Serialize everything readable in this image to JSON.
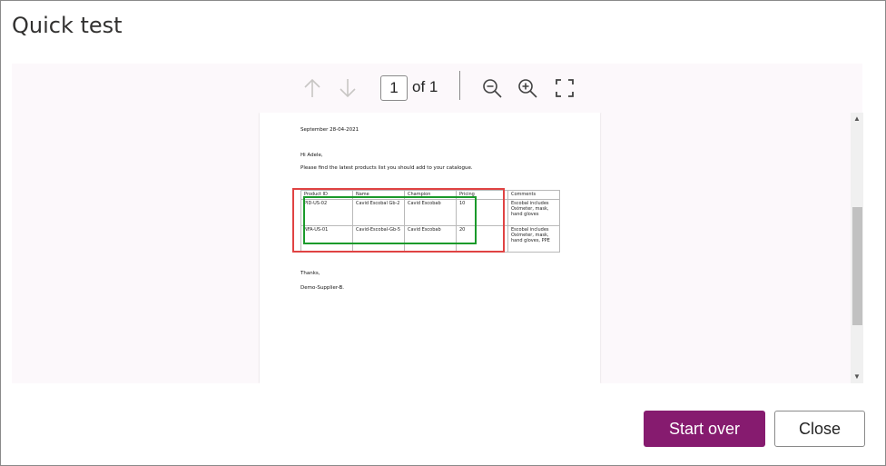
{
  "dialog": {
    "title": "Quick test"
  },
  "toolbar": {
    "prev_icon": "arrow-up-icon",
    "next_icon": "arrow-down-icon",
    "page_value": "1",
    "page_of": "of 1",
    "zoom_out_icon": "zoom-out-icon",
    "zoom_in_icon": "zoom-in-icon",
    "fit_icon": "fit-page-icon"
  },
  "document": {
    "date_line": "September 28-04-2021",
    "greeting": "Hi Adele,",
    "intro": "Please find the latest products list you should add to your catalogue.",
    "headers": [
      "Product ID",
      "Name",
      "Champion",
      "Pricing",
      "Comments"
    ],
    "rows": [
      [
        "PID-US-02",
        "Cavid Escobal Gb-2",
        "Cavid Escobab",
        "10",
        "Escobal includes Oximeter, mask, hand gloves"
      ],
      [
        "NFA-US-01",
        "Cavid-Escobal-Gb-5",
        "Cavid Escobab",
        "20",
        "Escobal includes Oximeter, mask, hand gloves, PPE"
      ]
    ],
    "thanks": "Thanks,",
    "signature": "Demo-Supplier-B."
  },
  "footer": {
    "start_over_label": "Start over",
    "close_label": "Close"
  },
  "colors": {
    "primary": "#861b6f",
    "highlight_red": "#e04343",
    "highlight_green": "#1a9a2a"
  }
}
